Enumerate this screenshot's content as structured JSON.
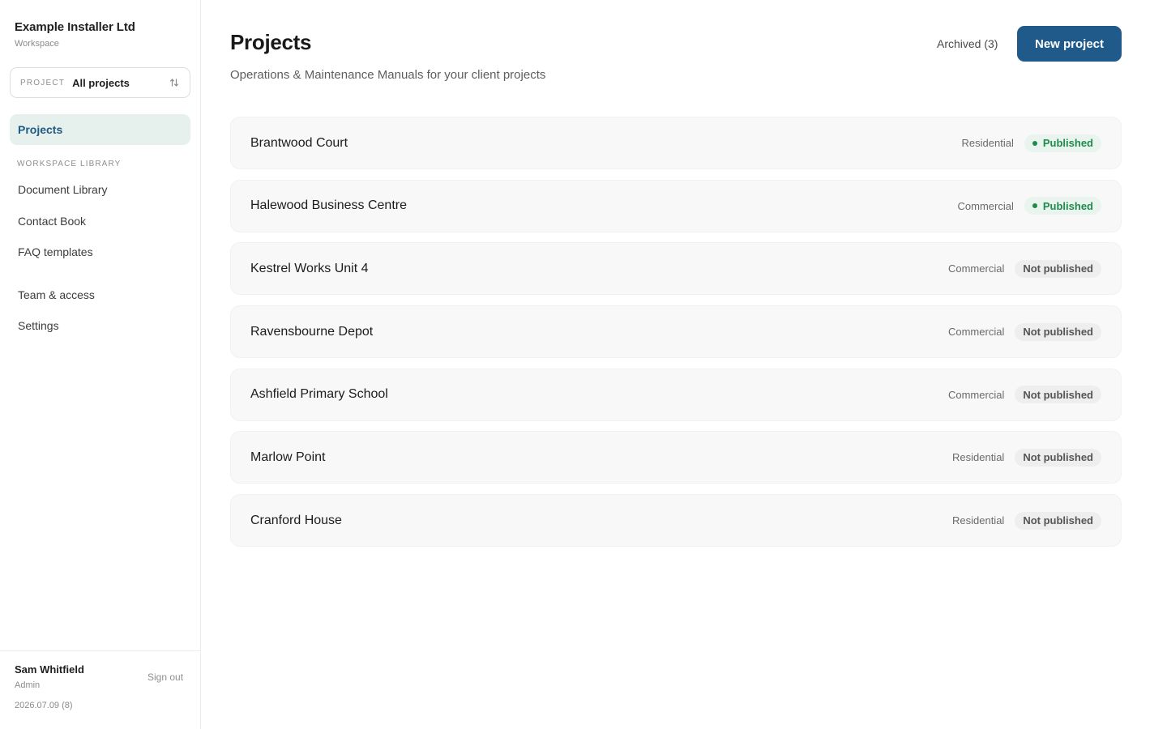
{
  "sidebar": {
    "workspace_name": "Example Installer Ltd",
    "workspace_label": "Workspace",
    "project_selector": {
      "label": "PROJECT",
      "value": "All projects"
    },
    "active_item": "Projects",
    "section_label": "WORKSPACE LIBRARY",
    "items": {
      "document_library": "Document Library",
      "contact_book": "Contact Book",
      "faq_templates": "FAQ templates",
      "team_access": "Team & access",
      "settings": "Settings"
    },
    "footer": {
      "user_name": "Sam Whitfield",
      "user_role": "Admin",
      "sign_out": "Sign out",
      "version": "2026.07.09 (8)"
    }
  },
  "header": {
    "title": "Projects",
    "subtitle": "Operations & Maintenance Manuals for your client projects",
    "archived_link": "Archived (3)",
    "new_project_button": "New project"
  },
  "projects": [
    {
      "name": "Brantwood Court",
      "type": "Residential",
      "status": "Published",
      "published": true
    },
    {
      "name": "Halewood Business Centre",
      "type": "Commercial",
      "status": "Published",
      "published": true
    },
    {
      "name": "Kestrel Works Unit 4",
      "type": "Commercial",
      "status": "Not published",
      "published": false
    },
    {
      "name": "Ravensbourne Depot",
      "type": "Commercial",
      "status": "Not published",
      "published": false
    },
    {
      "name": "Ashfield Primary School",
      "type": "Commercial",
      "status": "Not published",
      "published": false
    },
    {
      "name": "Marlow Point",
      "type": "Residential",
      "status": "Not published",
      "published": false
    },
    {
      "name": "Cranford House",
      "type": "Residential",
      "status": "Not published",
      "published": false
    }
  ],
  "icons": {
    "project_selector_arrows": "sort-arrows-icon",
    "published_dot": "status-dot-icon"
  },
  "colors": {
    "accent": "#1f5a8a",
    "active_nav_bg": "#e6f0ec",
    "published": "#1f8a4c",
    "published_bg": "#eaf4ee",
    "unpublished_bg": "#eeeeee"
  }
}
